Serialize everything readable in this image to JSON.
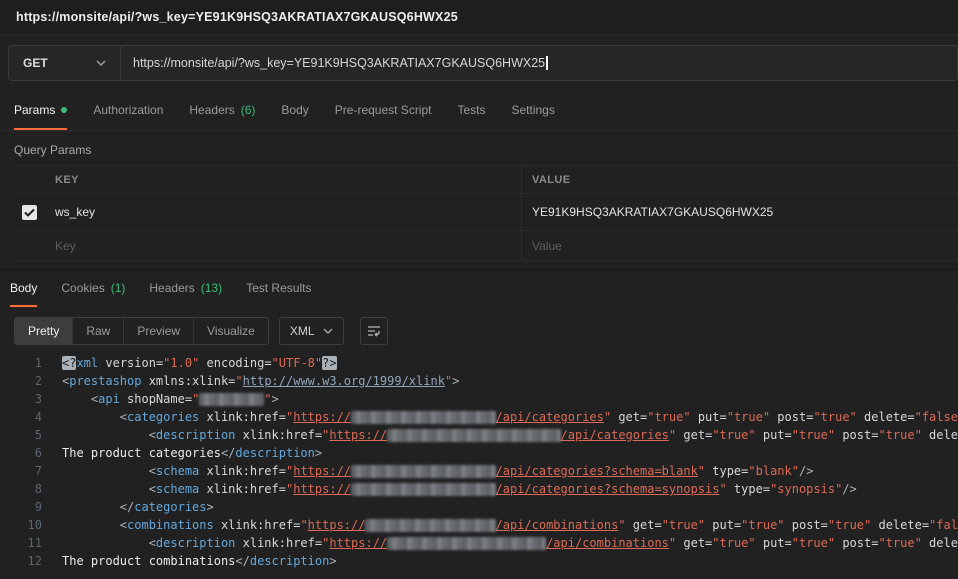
{
  "colors": {
    "accent_orange": "#ff6c37",
    "accent_green": "#3dbd7d"
  },
  "topbar": {
    "title": "https://monsite/api/?ws_key=YE91K9HSQ3AKRATIAX7GKAUSQ6HWX25"
  },
  "request": {
    "method": "GET",
    "url": "https://monsite/api/?ws_key=YE91K9HSQ3AKRATIAX7GKAUSQ6HWX25",
    "tabs": [
      {
        "label": "Params",
        "active": true,
        "dot": true
      },
      {
        "label": "Authorization"
      },
      {
        "label": "Headers",
        "count": "(6)"
      },
      {
        "label": "Body"
      },
      {
        "label": "Pre-request Script"
      },
      {
        "label": "Tests"
      },
      {
        "label": "Settings"
      }
    ]
  },
  "params": {
    "section_title": "Query Params",
    "columns": [
      "KEY",
      "VALUE"
    ],
    "rows": [
      {
        "key": "ws_key",
        "value": "YE91K9HSQ3AKRATIAX7GKAUSQ6HWX25",
        "checked": true
      }
    ],
    "placeholder": {
      "key": "Key",
      "value": "Value"
    }
  },
  "response": {
    "tabs": [
      {
        "label": "Body",
        "active": true
      },
      {
        "label": "Cookies",
        "count": "(1)"
      },
      {
        "label": "Headers",
        "count": "(13)"
      },
      {
        "label": "Test Results"
      }
    ],
    "view_tabs": [
      "Pretty",
      "Raw",
      "Preview",
      "Visualize"
    ],
    "format": "XML"
  },
  "icons": {
    "method_chevron": "chevron-down",
    "format_chevron": "chevron-down",
    "wrap_button": "wrap-text",
    "checkbox": "check"
  },
  "code": {
    "lines": [
      {
        "n": "1",
        "tokens": [
          {
            "c": "bh",
            "t": "<?"
          },
          {
            "c": "t",
            "t": "xml"
          },
          {
            "c": "a",
            "t": " version="
          },
          {
            "c": "s",
            "t": "\"1.0\""
          },
          {
            "c": "a",
            "t": " encoding="
          },
          {
            "c": "s",
            "t": "\"UTF-8\""
          },
          {
            "c": "bh",
            "t": "?>"
          }
        ]
      },
      {
        "n": "2",
        "tokens": [
          {
            "c": "p",
            "t": "<"
          },
          {
            "c": "t",
            "t": "prestashop"
          },
          {
            "c": "a",
            "t": " xmlns:xlink="
          },
          {
            "c": "s",
            "t": "\""
          },
          {
            "c": "lb",
            "t": "http://www.w3.org/1999/xlink"
          },
          {
            "c": "s",
            "t": "\""
          },
          {
            "c": "p",
            "t": ">"
          }
        ]
      },
      {
        "n": "3",
        "tokens": [
          {
            "c": "p",
            "t": "    <"
          },
          {
            "c": "t",
            "t": "api"
          },
          {
            "c": "a",
            "t": " shopName="
          },
          {
            "c": "s",
            "t": "\""
          },
          {
            "c": "b",
            "n": 9
          },
          {
            "c": "s",
            "t": "\""
          },
          {
            "c": "p",
            "t": ">"
          }
        ]
      },
      {
        "n": "4",
        "tokens": [
          {
            "c": "p",
            "t": "        <"
          },
          {
            "c": "t",
            "t": "categories"
          },
          {
            "c": "a",
            "t": " xlink:href="
          },
          {
            "c": "s",
            "t": "\""
          },
          {
            "c": "l",
            "t": "https://"
          },
          {
            "c": "b",
            "n": 20
          },
          {
            "c": "l",
            "t": "/api/categories"
          },
          {
            "c": "s",
            "t": "\""
          },
          {
            "c": "a",
            "t": " get="
          },
          {
            "c": "s",
            "t": "\"true\""
          },
          {
            "c": "a",
            "t": " put="
          },
          {
            "c": "s",
            "t": "\"true\""
          },
          {
            "c": "a",
            "t": " post="
          },
          {
            "c": "s",
            "t": "\"true\""
          },
          {
            "c": "a",
            "t": " delete="
          },
          {
            "c": "s",
            "t": "\"false\""
          }
        ]
      },
      {
        "n": "5",
        "tokens": [
          {
            "c": "p",
            "t": "            <"
          },
          {
            "c": "t",
            "t": "description"
          },
          {
            "c": "a",
            "t": " xlink:href="
          },
          {
            "c": "s",
            "t": "\""
          },
          {
            "c": "l",
            "t": "https://"
          },
          {
            "c": "b",
            "n": 24
          },
          {
            "c": "l",
            "t": "/api/categories"
          },
          {
            "c": "s",
            "t": "\""
          },
          {
            "c": "a",
            "t": " get="
          },
          {
            "c": "s",
            "t": "\"true\""
          },
          {
            "c": "a",
            "t": " put="
          },
          {
            "c": "s",
            "t": "\"true\""
          },
          {
            "c": "a",
            "t": " post="
          },
          {
            "c": "s",
            "t": "\"true\""
          },
          {
            "c": "a",
            "t": " delete="
          }
        ]
      },
      {
        "n": "6",
        "tokens": [
          {
            "c": "x",
            "t": "The product categories"
          },
          {
            "c": "p",
            "t": "</"
          },
          {
            "c": "t",
            "t": "description"
          },
          {
            "c": "p",
            "t": ">"
          }
        ]
      },
      {
        "n": "7",
        "tokens": [
          {
            "c": "p",
            "t": "            <"
          },
          {
            "c": "t",
            "t": "schema"
          },
          {
            "c": "a",
            "t": " xlink:href="
          },
          {
            "c": "s",
            "t": "\""
          },
          {
            "c": "l",
            "t": "https://"
          },
          {
            "c": "b",
            "n": 20
          },
          {
            "c": "l",
            "t": "/api/categories?schema=blank"
          },
          {
            "c": "s",
            "t": "\""
          },
          {
            "c": "a",
            "t": " type="
          },
          {
            "c": "s",
            "t": "\"blank\""
          },
          {
            "c": "p",
            "t": "/>"
          }
        ]
      },
      {
        "n": "8",
        "tokens": [
          {
            "c": "p",
            "t": "            <"
          },
          {
            "c": "t",
            "t": "schema"
          },
          {
            "c": "a",
            "t": " xlink:href="
          },
          {
            "c": "s",
            "t": "\""
          },
          {
            "c": "l",
            "t": "https://"
          },
          {
            "c": "b",
            "n": 20
          },
          {
            "c": "l",
            "t": "/api/categories?schema=synopsis"
          },
          {
            "c": "s",
            "t": "\""
          },
          {
            "c": "a",
            "t": " type="
          },
          {
            "c": "s",
            "t": "\"synopsis\""
          },
          {
            "c": "p",
            "t": "/>"
          }
        ]
      },
      {
        "n": "9",
        "tokens": [
          {
            "c": "p",
            "t": "        </"
          },
          {
            "c": "t",
            "t": "categories"
          },
          {
            "c": "p",
            "t": ">"
          }
        ]
      },
      {
        "n": "10",
        "tokens": [
          {
            "c": "p",
            "t": "        <"
          },
          {
            "c": "t",
            "t": "combinations"
          },
          {
            "c": "a",
            "t": " xlink:href="
          },
          {
            "c": "s",
            "t": "\""
          },
          {
            "c": "l",
            "t": "https://"
          },
          {
            "c": "b",
            "n": 18
          },
          {
            "c": "l",
            "t": "/api/combinations"
          },
          {
            "c": "s",
            "t": "\""
          },
          {
            "c": "a",
            "t": " get="
          },
          {
            "c": "s",
            "t": "\"true\""
          },
          {
            "c": "a",
            "t": " put="
          },
          {
            "c": "s",
            "t": "\"true\""
          },
          {
            "c": "a",
            "t": " post="
          },
          {
            "c": "s",
            "t": "\"true\""
          },
          {
            "c": "a",
            "t": " delete="
          },
          {
            "c": "s",
            "t": "\"false\""
          }
        ]
      },
      {
        "n": "11",
        "tokens": [
          {
            "c": "p",
            "t": "            <"
          },
          {
            "c": "t",
            "t": "description"
          },
          {
            "c": "a",
            "t": " xlink:href="
          },
          {
            "c": "s",
            "t": "\""
          },
          {
            "c": "l",
            "t": "https://"
          },
          {
            "c": "b",
            "n": 22
          },
          {
            "c": "l",
            "t": "/api/combinations"
          },
          {
            "c": "s",
            "t": "\""
          },
          {
            "c": "a",
            "t": " get="
          },
          {
            "c": "s",
            "t": "\"true\""
          },
          {
            "c": "a",
            "t": " put="
          },
          {
            "c": "s",
            "t": "\"true\""
          },
          {
            "c": "a",
            "t": " post="
          },
          {
            "c": "s",
            "t": "\"true\""
          },
          {
            "c": "a",
            "t": " delete="
          }
        ]
      },
      {
        "n": "12",
        "tokens": [
          {
            "c": "x",
            "t": "The product combinations"
          },
          {
            "c": "p",
            "t": "</"
          },
          {
            "c": "t",
            "t": "description"
          },
          {
            "c": "p",
            "t": ">"
          }
        ]
      }
    ]
  }
}
